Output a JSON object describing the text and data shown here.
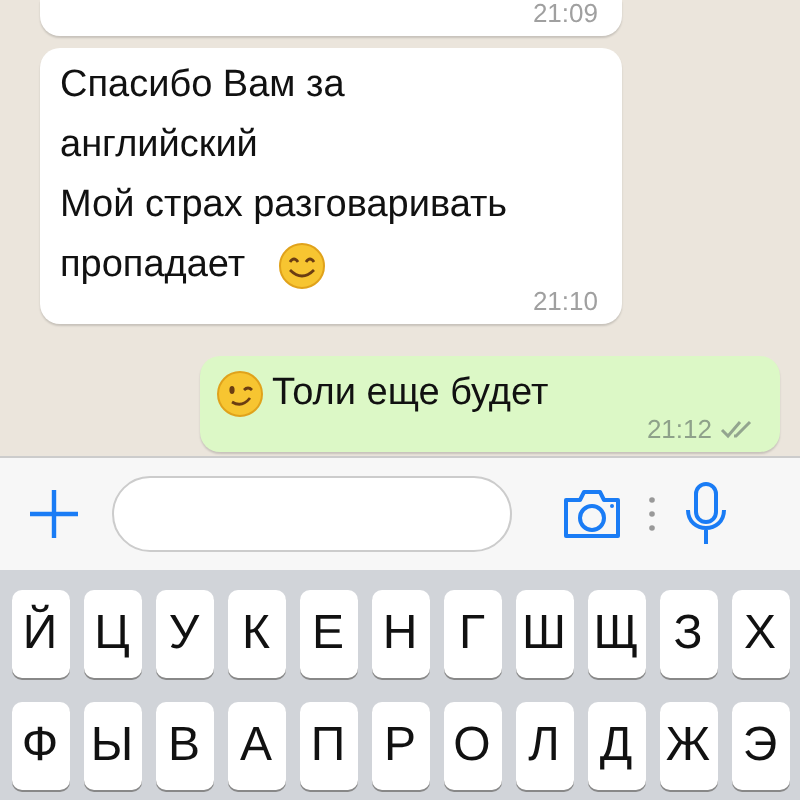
{
  "messages": [
    {
      "kind": "incoming",
      "time": "21:09",
      "cut": true
    },
    {
      "kind": "incoming",
      "lines": [
        "Спасибо Вам за",
        "английский",
        "Мой страх разговаривать",
        "пропадает"
      ],
      "emoji": {
        "kind": "smile",
        "at_end": true
      },
      "time": "21:10",
      "cut": false
    },
    {
      "kind": "outgoing",
      "lines": [
        "Толи еще будет"
      ],
      "emoji": {
        "kind": "wink",
        "at_end": false
      },
      "time": "21:12",
      "read": true,
      "cut": false
    }
  ],
  "keyboard": {
    "rows": [
      [
        "Й",
        "Ц",
        "У",
        "К",
        "Е",
        "Н",
        "Г",
        "Ш",
        "Щ",
        "З",
        "Х"
      ],
      [
        "Ф",
        "Ы",
        "В",
        "А",
        "П",
        "Р",
        "О",
        "Л",
        "Д",
        "Ж",
        "Э"
      ]
    ]
  }
}
